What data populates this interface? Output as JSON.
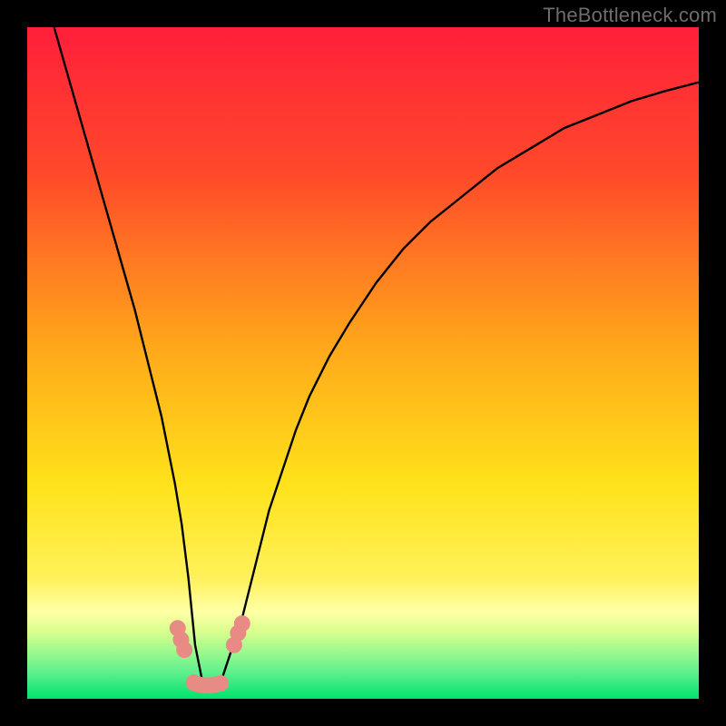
{
  "watermark": "TheBottleneck.com",
  "colors": {
    "page_bg": "#000000",
    "gradient_top": "#ff1f3a",
    "gradient_mid1": "#ff7a1a",
    "gradient_mid2": "#ffe21a",
    "gradient_band_light": "#ffffa6",
    "gradient_bottom_band": "#72f59d",
    "gradient_bottom_edge": "#00e36b",
    "curve": "#000000",
    "marker_fill": "#e98b85",
    "marker_stroke": "#e98b85"
  },
  "chart_data": {
    "type": "line",
    "title": "",
    "xlabel": "",
    "ylabel": "",
    "xlim": [
      0,
      100
    ],
    "ylim": [
      0,
      100
    ],
    "series": [
      {
        "name": "bottleneck-curve",
        "x": [
          4,
          6,
          8,
          10,
          12,
          14,
          16,
          18,
          20,
          22,
          23,
          24,
          25,
          26,
          27,
          28,
          29,
          30,
          32,
          34,
          36,
          38,
          40,
          42,
          45,
          48,
          52,
          56,
          60,
          65,
          70,
          75,
          80,
          85,
          90,
          95,
          100
        ],
        "y": [
          100,
          93,
          86,
          79,
          72,
          65,
          58,
          50,
          42,
          32,
          26,
          18,
          8,
          3,
          2,
          2,
          3,
          6,
          12,
          20,
          28,
          34,
          40,
          45,
          51,
          56,
          62,
          67,
          71,
          75,
          79,
          82,
          85,
          87,
          89,
          90.5,
          91.8
        ]
      }
    ],
    "markers": [
      {
        "x": 22.4,
        "y": 10.5
      },
      {
        "x": 22.9,
        "y": 8.8
      },
      {
        "x": 23.4,
        "y": 7.3
      },
      {
        "x": 24.8,
        "y": 2.4
      },
      {
        "x": 25.6,
        "y": 2.1
      },
      {
        "x": 26.4,
        "y": 2.0
      },
      {
        "x": 27.2,
        "y": 2.0
      },
      {
        "x": 28.0,
        "y": 2.1
      },
      {
        "x": 28.8,
        "y": 2.3
      },
      {
        "x": 30.8,
        "y": 8.0
      },
      {
        "x": 31.4,
        "y": 9.8
      },
      {
        "x": 32.0,
        "y": 11.2
      }
    ],
    "gradient_stops_pct": [
      {
        "offset": 0,
        "color": "#ff1f3a"
      },
      {
        "offset": 22,
        "color": "#ff4a2a"
      },
      {
        "offset": 48,
        "color": "#ffa91a"
      },
      {
        "offset": 68,
        "color": "#ffe21a"
      },
      {
        "offset": 82,
        "color": "#fff15a"
      },
      {
        "offset": 87,
        "color": "#ffffa6"
      },
      {
        "offset": 90,
        "color": "#d9ff8e"
      },
      {
        "offset": 93,
        "color": "#9cf98e"
      },
      {
        "offset": 96,
        "color": "#5ff08e"
      },
      {
        "offset": 100,
        "color": "#00e36b"
      }
    ]
  }
}
